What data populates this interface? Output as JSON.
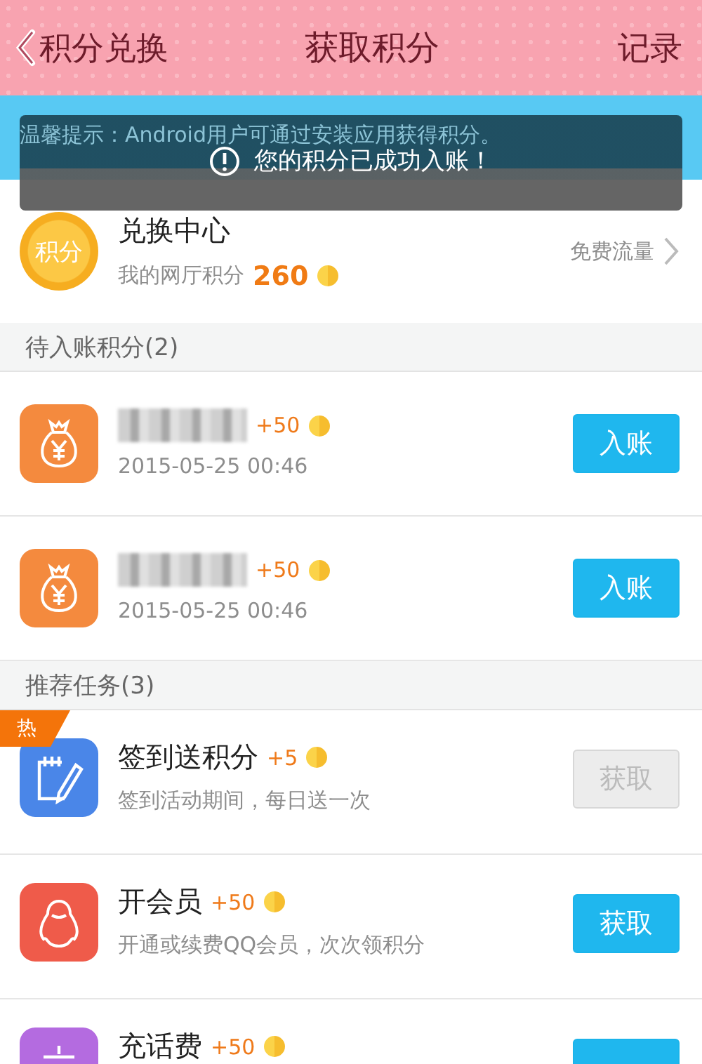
{
  "header": {
    "back_label": "积分兑换",
    "title": "获取积分",
    "action": "记录"
  },
  "tip": "温馨提示：Android用户可通过安装应用获得积分。",
  "toast": {
    "text": "您的积分已成功入账！"
  },
  "exchange": {
    "badge": "积分",
    "title": "兑换中心",
    "points_label": "我的网厅积分",
    "points": "260",
    "link": "免费流量"
  },
  "pending": {
    "title": "待入账积分(2)",
    "items": [
      {
        "bonus": "+50",
        "time": "2015-05-25 00:46",
        "button": "入账"
      },
      {
        "bonus": "+50",
        "time": "2015-05-25 00:46",
        "button": "入账"
      }
    ]
  },
  "tasks": {
    "title": "推荐任务(3)",
    "items": [
      {
        "kind": "notepad",
        "hot": true,
        "hot_label": "热",
        "name": "签到送积分",
        "bonus": "+5",
        "desc": "签到活动期间，每日送一次",
        "button": "获取",
        "disabled": true
      },
      {
        "kind": "penguin",
        "hot": false,
        "name": "开会员",
        "bonus": "+50",
        "desc": "开通或续费QQ会员，次次领积分",
        "button": "获取",
        "disabled": false
      },
      {
        "kind": "phone",
        "hot": false,
        "name": "充话费",
        "bonus": "+50",
        "disabled": false
      }
    ]
  }
}
